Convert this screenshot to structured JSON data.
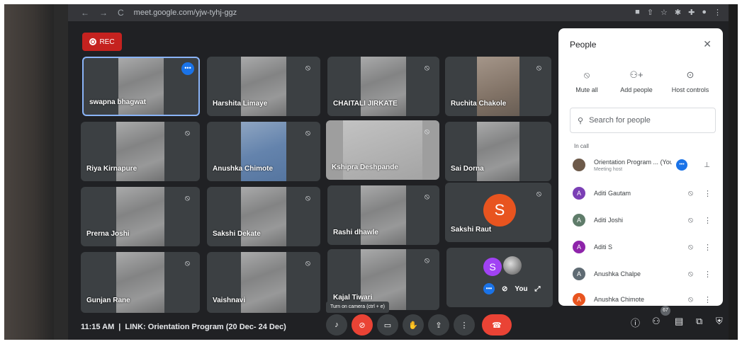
{
  "browser": {
    "url": "meet.google.com/yjw-tyhj-ggz",
    "back": "←",
    "forward": "→",
    "reload": "C"
  },
  "rec_label": "REC",
  "tiles": [
    {
      "name": "swapna bhagwat"
    },
    {
      "name": "Harshita Limaye"
    },
    {
      "name": "CHAITALI JIRKATE"
    },
    {
      "name": "Ruchita Chakole"
    },
    {
      "name": "Riya Kirnapure"
    },
    {
      "name": "Anushka Chimote"
    },
    {
      "name": "Kshipra Deshpande"
    },
    {
      "name": "Sai Dorna"
    },
    {
      "name": "Prerna Joshi"
    },
    {
      "name": "Sakshi Dekate"
    },
    {
      "name": "Rashi dhawle"
    },
    {
      "name": "Sakshi Raut",
      "initial": "S"
    },
    {
      "name": "Gunjan Rane"
    },
    {
      "name": "Vaishnavi"
    },
    {
      "name": "Kajal Tiwari"
    }
  ],
  "self_tile": {
    "initial": "S",
    "label": "You"
  },
  "people_panel": {
    "title": "People",
    "actions": [
      {
        "label": "Mute all",
        "icon": "mic-off-icon"
      },
      {
        "label": "Add people",
        "icon": "add-person-icon"
      },
      {
        "label": "Host controls",
        "icon": "toggle-icon"
      }
    ],
    "search_placeholder": "Search for people",
    "section_label": "In call",
    "participants": [
      {
        "name": "Orientation Program ...",
        "suffix": "(You)",
        "sub": "Meeting host",
        "initial": "",
        "color": "#6d5a4a"
      },
      {
        "name": "Aditi Gautam",
        "initial": "A",
        "color": "#7b3fb5"
      },
      {
        "name": "Aditi Joshi",
        "initial": "A",
        "color": "#5f7c6a"
      },
      {
        "name": "Aditi S",
        "initial": "A",
        "color": "#8e24aa"
      },
      {
        "name": "Anushka Chalpe",
        "initial": "A",
        "color": "#5f6b73"
      },
      {
        "name": "Anushka Chimote",
        "initial": "A",
        "color": "#e8541f"
      }
    ]
  },
  "bottom": {
    "time": "11:15 AM",
    "separator": "|",
    "meeting_name": "LINK: Orientation Program (20 Dec- 24 Dec)",
    "tooltip": "Turn on camera (ctrl + e)",
    "participant_count": "67"
  }
}
